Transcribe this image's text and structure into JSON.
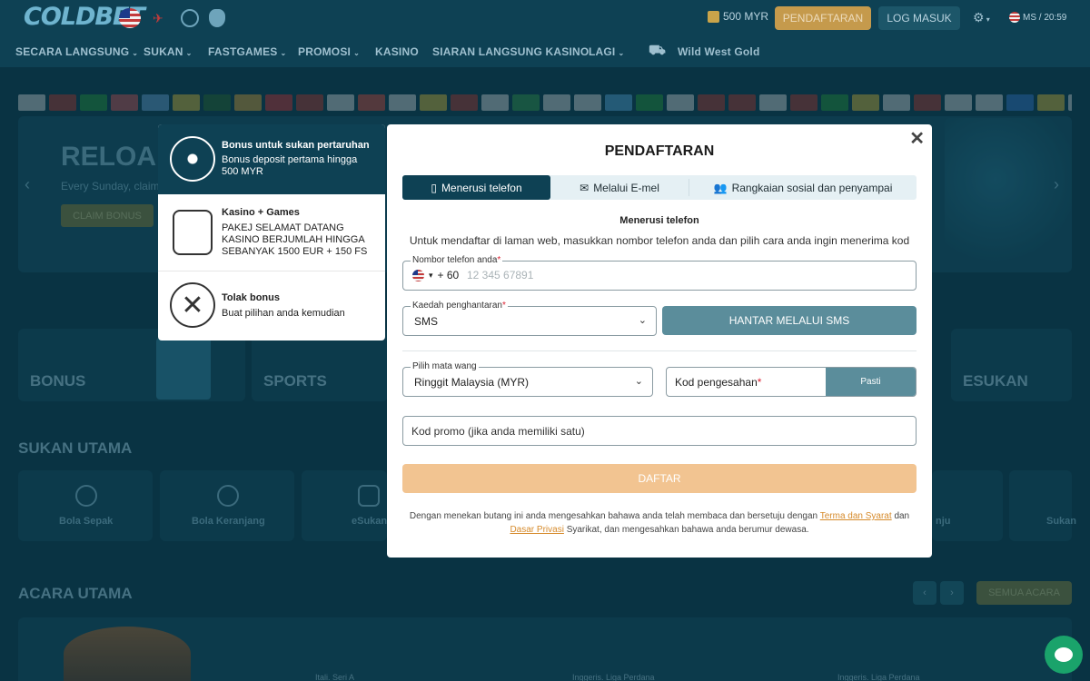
{
  "header": {
    "logo": "COLDBET",
    "balance": "500 MYR",
    "register_label": "PENDAFTARAN",
    "login_label": "LOG MASUK",
    "lang_time": "MS / 20:59",
    "icons": [
      "malaysia-flag-icon",
      "airplane-icon",
      "champions-league-icon",
      "premier-league-icon",
      "gift-icon",
      "gear-icon"
    ]
  },
  "nav": {
    "items": [
      {
        "label": "SECARA LANGSUNG",
        "dropdown": true
      },
      {
        "label": "SUKAN",
        "dropdown": true
      },
      {
        "label": "FASTGAMES",
        "dropdown": true
      },
      {
        "label": "PROMOSI",
        "dropdown": true
      },
      {
        "label": "KASINO",
        "dropdown": false
      },
      {
        "label": "SIARAN LANGSUNG KASINO",
        "dropdown": false
      },
      {
        "label": "LAGI",
        "dropdown": true
      }
    ],
    "promo_game": "Wild West Gold"
  },
  "banner": {
    "title": "RELOAD",
    "subtitle": "Every Sunday, claim a",
    "button": "CLAIM BONUS"
  },
  "categories": [
    "BONUS",
    "SPORTS",
    "ESUKAN"
  ],
  "sports_section": {
    "title": "SUKAN UTAMA",
    "items": [
      "Bola Sepak",
      "Bola Keranjang",
      "eSukan",
      "nju",
      "Sukan"
    ]
  },
  "events_section": {
    "title": "ACARA UTAMA",
    "all_button": "SEMUA ACARA",
    "leagues": [
      "Itali. Seri A",
      "Inggeris. Liga Perdana",
      "Inggeris. Liga Perdana"
    ]
  },
  "bonus_panel": {
    "items": [
      {
        "title": "Bonus untuk sukan pertaruhan",
        "desc": "Bonus deposit pertama hingga 500 MYR",
        "icon": "soccer-ball-icon",
        "selected": true
      },
      {
        "title": "Kasino + Games",
        "desc": "PAKEJ SELAMAT DATANG KASINO BERJUMLAH HINGGA SEBANYAK 1500 EUR + 150 FS",
        "icon": "casino-chips-icon",
        "selected": false
      },
      {
        "title": "Tolak bonus",
        "desc": "Buat pilihan anda kemudian",
        "icon": "close-circle-icon",
        "selected": false
      }
    ]
  },
  "modal": {
    "title": "PENDAFTARAN",
    "tabs": [
      {
        "label": "Menerusi telefon",
        "icon": "phone-icon",
        "active": true
      },
      {
        "label": "Melalui E-mel",
        "icon": "mail-icon",
        "active": false
      },
      {
        "label": "Rangkaian sosial dan penyampai",
        "icon": "users-icon",
        "active": false
      }
    ],
    "section_title": "Menerusi telefon",
    "section_desc": "Untuk mendaftar di laman web, masukkan nombor telefon anda dan pilih cara anda ingin menerima kod",
    "phone_label": "Nombor telefon anda",
    "phone_code": "+ 60",
    "phone_placeholder": "12 345 67891",
    "delivery_label": "Kaedah penghantaran",
    "delivery_value": "SMS",
    "send_sms": "HANTAR MELALUI SMS",
    "currency_label": "Pilih mata wang",
    "currency_value": "Ringgit Malaysia (MYR)",
    "verify_label": "Kod pengesahan",
    "verify_button": "Pasti",
    "promo_placeholder": "Kod promo (jika anda memiliki satu)",
    "submit": "DAFTAR",
    "legal_before": "Dengan menekan butang ini anda mengesahkan bahawa anda telah membaca dan bersetuju dengan",
    "legal_terms": "Terma dan Syarat",
    "legal_and": "dan",
    "legal_privacy": "Dasar Privasi",
    "legal_after": "Syarikat, dan mengesahkan bahawa anda berumur dewasa.",
    "required_mark": "*"
  }
}
